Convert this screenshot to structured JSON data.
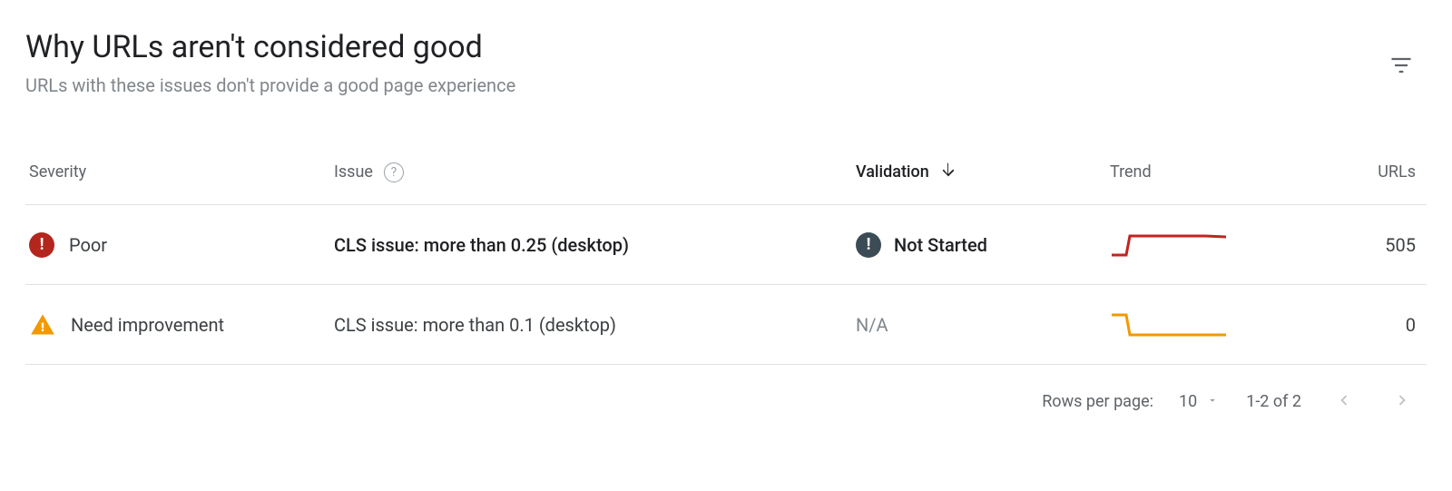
{
  "header": {
    "title": "Why URLs aren't considered good",
    "subtitle": "URLs with these issues don't provide a good page experience"
  },
  "columns": {
    "severity": "Severity",
    "issue": "Issue",
    "validation": "Validation",
    "trend": "Trend",
    "urls": "URLs"
  },
  "rows": [
    {
      "severity_label": "Poor",
      "issue": "CLS issue: more than 0.25 (desktop)",
      "validation": "Not Started",
      "urls": "505"
    },
    {
      "severity_label": "Need improvement",
      "issue": "CLS issue: more than 0.1 (desktop)",
      "validation": "N/A",
      "urls": "0"
    }
  ],
  "pager": {
    "rows_per_page_label": "Rows per page:",
    "rows_per_page_value": "10",
    "range": "1-2 of 2"
  }
}
